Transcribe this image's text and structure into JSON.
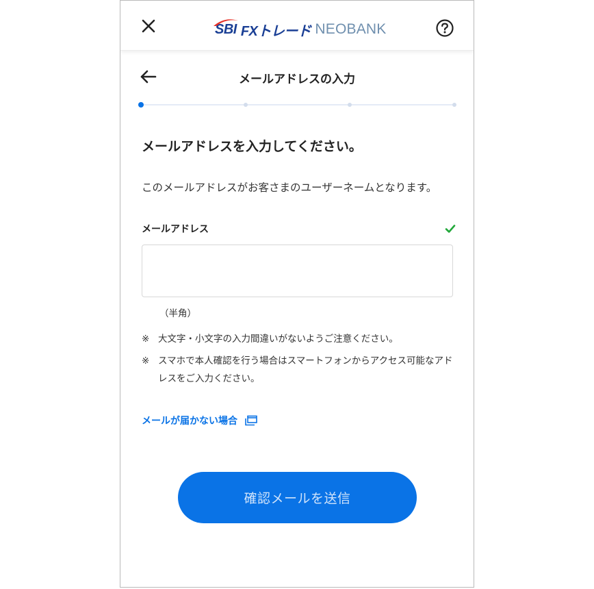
{
  "header": {
    "logo": {
      "sbi": "SBI",
      "fx": "FXトレード",
      "neobank": "NEOBANK",
      "swoosh_color": "#e6332a"
    },
    "close_icon": "close-icon",
    "help_icon": "help-icon"
  },
  "subheader": {
    "title": "メールアドレスの入力",
    "back_icon": "arrow-left-icon"
  },
  "stepper": {
    "total_steps": 4,
    "current_step": 1,
    "active_color": "#0a73e6"
  },
  "form": {
    "heading": "メールアドレスを入力してください。",
    "description": "このメールアドレスがお客さまのユーザーネームとなります。",
    "email_label": "メールアドレス",
    "email_value": "",
    "email_placeholder": "",
    "hint": "（半角）",
    "note_mark": "※",
    "notes": [
      "大文字・小文字の入力間違いがないようご注意ください。",
      "スマホで本人確認を行う場合はスマートフォンからアクセス可能なアドレスをご入力ください。"
    ],
    "help_link": "メールが届かない場合",
    "submit_label": "確認メールを送信"
  },
  "colors": {
    "primary": "#0a73e6",
    "check": "#22a83a",
    "logo_navy": "#1a3f95",
    "logo_grey": "#6f8fae"
  }
}
